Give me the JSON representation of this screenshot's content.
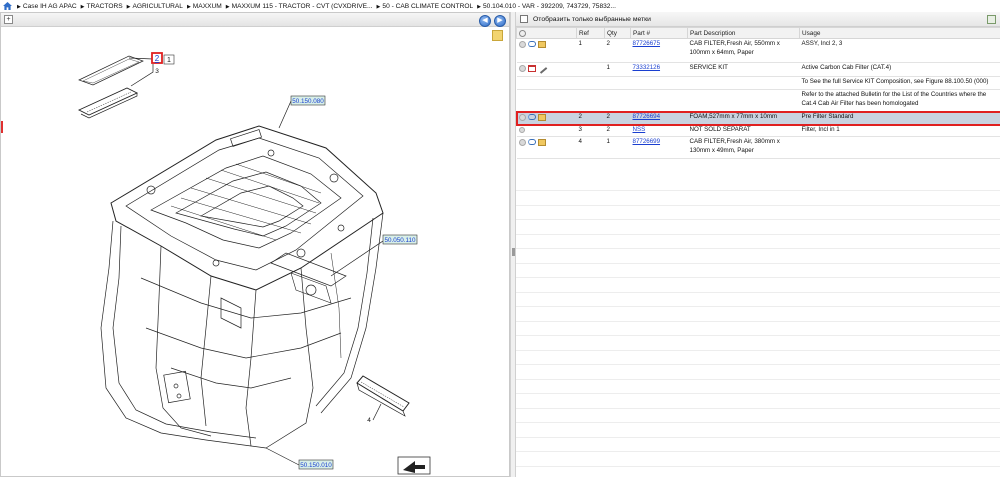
{
  "breadcrumb": [
    "Case IH AG APAC",
    "TRACTORS",
    "AGRICULTURAL",
    "MAXXUM",
    "MAXXUM 115 - TRACTOR - CVT (CVXDRIVE...",
    "50 - CAB CLIMATE CONTROL",
    "50.104.010 - VAR - 392209, 743729, 75832..."
  ],
  "right_toolbar": {
    "filter_label": "Отобразить только выбранные метки"
  },
  "table": {
    "headers": {
      "ref": "Ref",
      "qty": "Qty",
      "part": "Part #",
      "desc": "Part Description",
      "usage": "Usage"
    },
    "rows": [
      {
        "ref": "1",
        "qty": "2",
        "part": "87726675",
        "desc": "CAB FILTER,Fresh Air, 550mm x 100mm x 64mm, Paper",
        "usage": "ASSY, Incl 2, 3",
        "icons": [
          "circle-icon",
          "link-icon",
          "box-icon"
        ]
      },
      {
        "ref": "",
        "qty": "1",
        "part": "73332126",
        "desc": "SERVICE KIT",
        "usage": "Active Carbon Cab Filter (CAT.4)",
        "icons": [
          "circle-icon",
          "book-icon",
          "tool-icon"
        ]
      },
      {
        "ref": "",
        "qty": "",
        "part": "",
        "desc": "",
        "usage": "To See the full Service KIT Composition, see Figure 88.100.50 (000)",
        "icons": []
      },
      {
        "ref": "",
        "qty": "",
        "part": "",
        "desc": "",
        "usage": "Refer to the attached Bulletin for the List of the Countries where the Cat.4 Cab Air Filter has been homologated",
        "icons": []
      },
      {
        "ref": "2",
        "qty": "2",
        "part": "87726694",
        "desc": "FOAM,527mm x 77mm x 10mm",
        "usage": "Pre Filter Standard",
        "icons": [
          "circle-icon",
          "link-icon",
          "box-icon"
        ],
        "selected": true
      },
      {
        "ref": "3",
        "qty": "2",
        "part": "NSS",
        "desc": "NOT SOLD SEPARAT",
        "usage": "Filter, Incl in 1",
        "icons": [
          "circle-icon"
        ]
      },
      {
        "ref": "4",
        "qty": "1",
        "part": "87726699",
        "desc": "CAB FILTER,Fresh Air, 380mm x 130mm x 49mm, Paper",
        "usage": "",
        "icons": [
          "circle-icon",
          "link-icon",
          "box-icon"
        ]
      }
    ]
  },
  "drawing": {
    "callouts": {
      "c2": "2",
      "c1": "1",
      "c3": "3",
      "c4": "4"
    },
    "refs": {
      "r1": "50.150.080",
      "r2": "50.050.110",
      "r3": "50.150.010"
    }
  },
  "colors": {
    "highlight": "#e02020",
    "link": "#1a3fd0",
    "selected_row": "#c9d3e0",
    "ref_box": "#d8efe8"
  }
}
